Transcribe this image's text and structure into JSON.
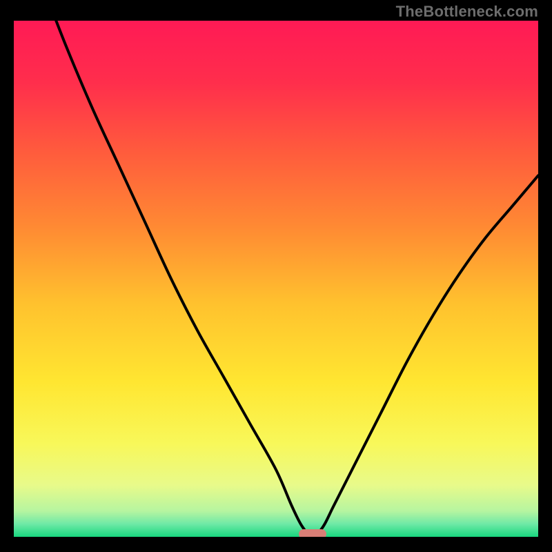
{
  "watermark": {
    "text": "TheBottleneck.com"
  },
  "colors": {
    "gradient_stops": [
      {
        "offset": 0.0,
        "color": "#ff1a55"
      },
      {
        "offset": 0.12,
        "color": "#ff2e4c"
      },
      {
        "offset": 0.25,
        "color": "#ff5a3d"
      },
      {
        "offset": 0.4,
        "color": "#ff8a33"
      },
      {
        "offset": 0.55,
        "color": "#ffc22e"
      },
      {
        "offset": 0.7,
        "color": "#ffe631"
      },
      {
        "offset": 0.82,
        "color": "#f8f85a"
      },
      {
        "offset": 0.9,
        "color": "#e8fa8a"
      },
      {
        "offset": 0.95,
        "color": "#b6f5a0"
      },
      {
        "offset": 0.975,
        "color": "#6fe9a6"
      },
      {
        "offset": 1.0,
        "color": "#18d77f"
      }
    ],
    "curve": "#000000",
    "marker": "#d87e76",
    "background": "#000000"
  },
  "chart_data": {
    "type": "line",
    "title": "",
    "xlabel": "",
    "ylabel": "",
    "xlim": [
      0,
      100
    ],
    "ylim": [
      0,
      100
    ],
    "grid": false,
    "legend": false,
    "minimum_marker": {
      "x": 57,
      "y": 0
    },
    "series": [
      {
        "name": "bottleneck-curve",
        "x": [
          0,
          5,
          10,
          15,
          20,
          25,
          30,
          35,
          40,
          45,
          50,
          53,
          55,
          57,
          59,
          61,
          65,
          70,
          75,
          80,
          85,
          90,
          95,
          100
        ],
        "y": [
          120,
          108,
          95,
          83,
          72,
          61,
          50,
          40,
          31,
          22,
          13,
          6,
          2,
          0,
          2,
          6,
          14,
          24,
          34,
          43,
          51,
          58,
          64,
          70
        ]
      }
    ]
  }
}
